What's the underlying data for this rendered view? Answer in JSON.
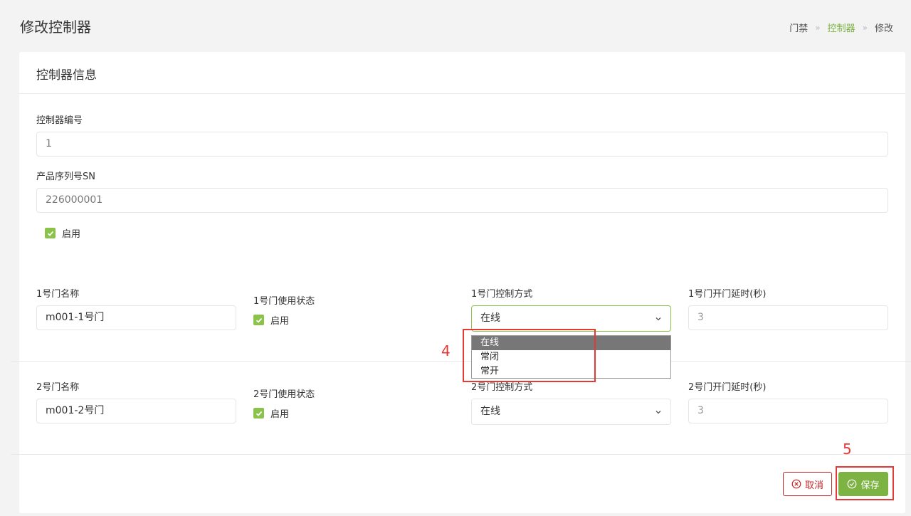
{
  "header": {
    "title": "修改控制器",
    "breadcrumb": [
      "门禁",
      "控制器",
      "修改"
    ]
  },
  "card": {
    "title": "控制器信息"
  },
  "form": {
    "controller_no": {
      "label": "控制器编号",
      "value": "1"
    },
    "serial": {
      "label": "产品序列号SN",
      "value": "226000001"
    },
    "enabled_label": "启用",
    "door1": {
      "name_label": "1号门名称",
      "name_value": "m001-1号门",
      "status_label": "1号门使用状态",
      "status_check_label": "启用",
      "mode_label": "1号门控制方式",
      "mode_value": "在线",
      "delay_label": "1号门开门延时(秒)",
      "delay_placeholder": "3"
    },
    "door2": {
      "name_label": "2号门名称",
      "name_value": "m001-2号门",
      "status_label": "2号门使用状态",
      "status_check_label": "启用",
      "mode_label": "2号门控制方式",
      "mode_value": "在线",
      "delay_label": "2号门开门延时(秒)",
      "delay_placeholder": "3"
    }
  },
  "dropdown": {
    "options": [
      "在线",
      "常闭",
      "常开"
    ],
    "selected": "在线"
  },
  "annotations": [
    "4",
    "5"
  ],
  "buttons": {
    "cancel": "取消",
    "save": "保存"
  },
  "colors": {
    "accent": "#7cb342",
    "danger": "#c62828",
    "annotation": "#e53935"
  }
}
